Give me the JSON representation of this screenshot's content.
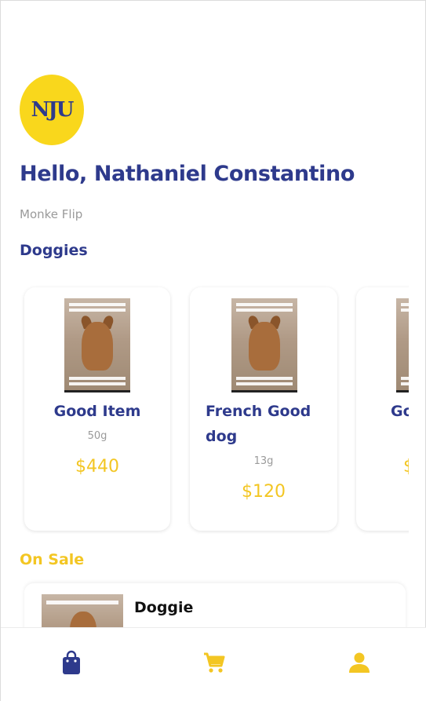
{
  "header": {
    "logo_text": "NJU",
    "greeting": "Hello, Nathaniel Constantino",
    "subtitle": "Monke Flip"
  },
  "sections": {
    "doggies_title": "Doggies",
    "sale_title": "On Sale"
  },
  "products": [
    {
      "name": "Good Item",
      "weight": "50g",
      "price": "$440"
    },
    {
      "name": "French Good dog",
      "weight": "13g",
      "price": "$120"
    },
    {
      "name": "Go",
      "price": "$"
    }
  ],
  "sale_items": [
    {
      "name": "Doggie"
    }
  ],
  "bottom_nav": {
    "items": [
      {
        "icon": "shopping-bag-icon",
        "active": true
      },
      {
        "icon": "cart-icon",
        "active": false
      },
      {
        "icon": "person-icon",
        "active": false
      }
    ]
  },
  "colors": {
    "primary_navy": "#2e3a8c",
    "accent_yellow": "#f3c623",
    "logo_yellow": "#f9d71c",
    "muted_gray": "#9a9a9a"
  }
}
